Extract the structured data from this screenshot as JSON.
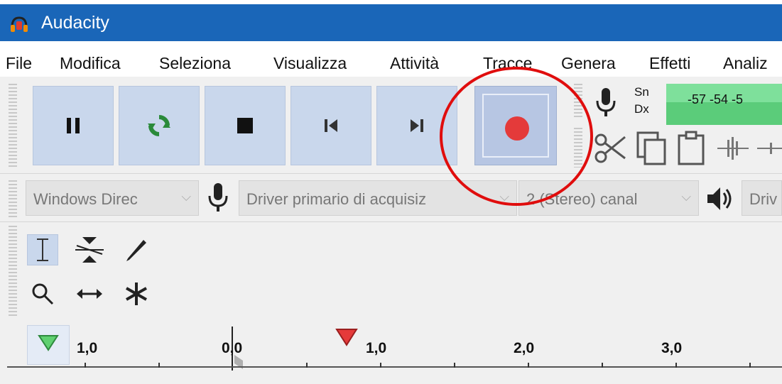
{
  "window": {
    "title": "Audacity",
    "icon": "audacity-headphones-icon"
  },
  "menu": [
    "File",
    "Modifica",
    "Seleziona",
    "Visualizza",
    "Attività",
    "Tracce",
    "Genera",
    "Effetti",
    "Analiz"
  ],
  "transport": {
    "pause": "pause-icon",
    "loop": "loop-icon",
    "stop": "stop-icon",
    "skip_start": "skip-to-start-icon",
    "skip_end": "skip-to-end-icon",
    "record": "record-icon",
    "record_color": "#e43a3a",
    "button_color": "#c9d7ec"
  },
  "meter": {
    "left_label": "Sn",
    "right_label": "Dx",
    "scale": "-57  -54  -5"
  },
  "device": {
    "host": "Windows Direc",
    "recording_device": "Driver primario di acquisiz",
    "channels": "2 (Stereo) canal",
    "playback_device": "Driv"
  },
  "ruler": {
    "labels": [
      "1,0",
      "0,0",
      "1,0",
      "2,0",
      "3,0"
    ]
  },
  "annotation": {
    "color": "#e00d0d"
  }
}
